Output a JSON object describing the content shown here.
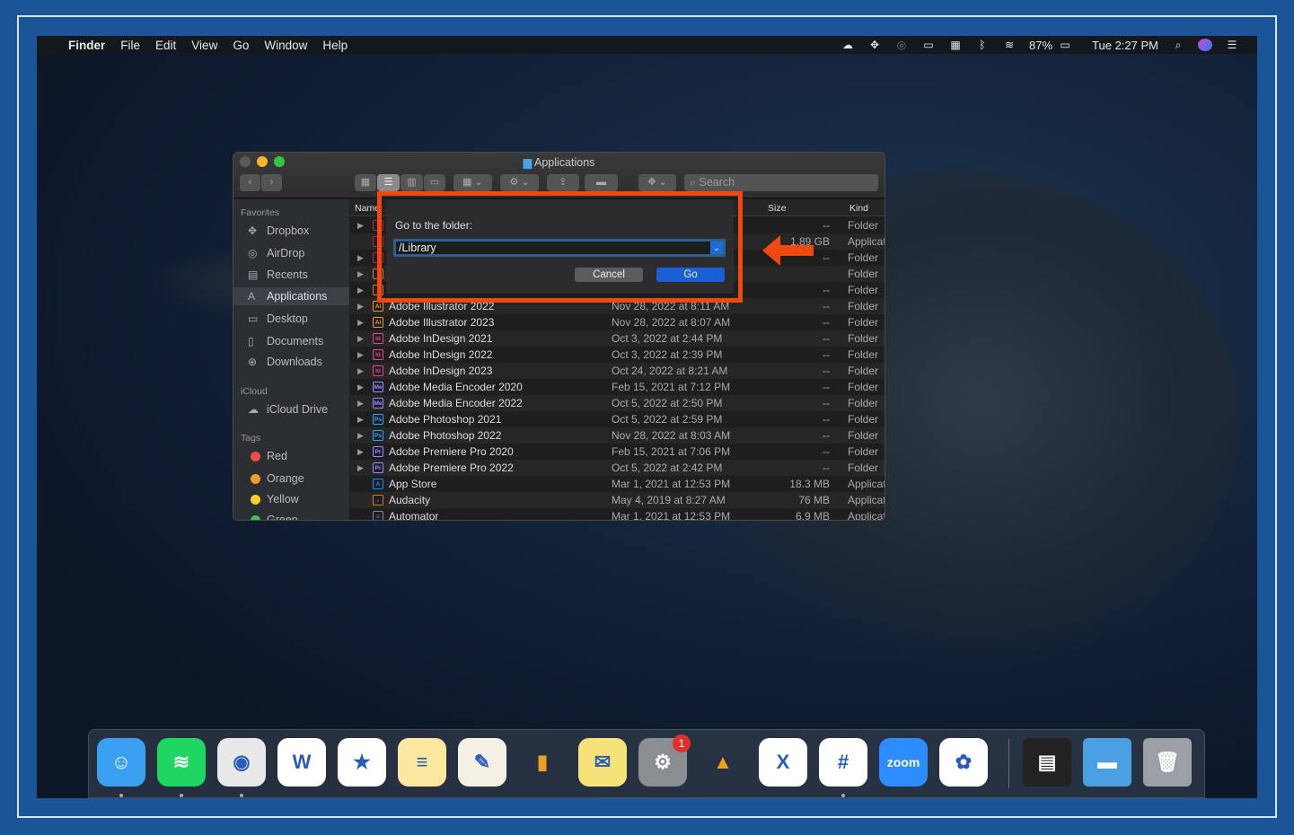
{
  "menubar": {
    "app": "Finder",
    "menus": [
      "File",
      "Edit",
      "View",
      "Go",
      "Window",
      "Help"
    ],
    "battery": "87%",
    "clock": "Tue 2:27 PM",
    "status_icons": [
      "creative-cloud-icon",
      "dropbox-icon",
      "spotlight-alt-icon",
      "airplay-icon",
      "control-icon",
      "bluetooth-icon",
      "wifi-icon",
      "battery-icon",
      "search-icon",
      "siri-icon",
      "notification-center-icon"
    ]
  },
  "window": {
    "title": "Applications",
    "search_placeholder": "Search"
  },
  "sidebar": {
    "favorites_header": "Favorites",
    "favorites": [
      {
        "label": "Dropbox",
        "icon": "dropbox-icon"
      },
      {
        "label": "AirDrop",
        "icon": "airdrop-icon"
      },
      {
        "label": "Recents",
        "icon": "recents-icon"
      },
      {
        "label": "Applications",
        "icon": "applications-icon"
      },
      {
        "label": "Desktop",
        "icon": "desktop-icon"
      },
      {
        "label": "Documents",
        "icon": "documents-icon"
      },
      {
        "label": "Downloads",
        "icon": "downloads-icon"
      }
    ],
    "icloud_header": "iCloud",
    "icloud": [
      {
        "label": "iCloud Drive",
        "icon": "cloud-icon"
      }
    ],
    "tags_header": "Tags",
    "tags": [
      {
        "label": "Red",
        "color": "#ee4b45"
      },
      {
        "label": "Orange",
        "color": "#f39a2c"
      },
      {
        "label": "Yellow",
        "color": "#f5cf2d"
      },
      {
        "label": "Green",
        "color": "#3fc34f"
      }
    ]
  },
  "list": {
    "columns": {
      "name": "Name",
      "size": "Size",
      "kind": "Kind"
    },
    "rows": [
      {
        "name": "",
        "date": "",
        "size": "--",
        "kind": "Folder",
        "folder": true,
        "badge": "",
        "color": "#c0202a"
      },
      {
        "name": "",
        "date": "",
        "size": "1.89 GB",
        "kind": "Application",
        "folder": false,
        "badge": "",
        "color": "#c0202a"
      },
      {
        "name": "",
        "date": "",
        "size": "--",
        "kind": "Folder",
        "folder": true,
        "badge": "",
        "color": "#c0202a"
      },
      {
        "name": "",
        "date": "",
        "size": "",
        "kind": "Folder",
        "folder": true,
        "badge": "",
        "color": "#e07a1a"
      },
      {
        "name": "",
        "date": "",
        "size": "--",
        "kind": "Folder",
        "folder": true,
        "badge": "",
        "color": "#e07a1a"
      },
      {
        "name": "Adobe Illustrator 2022",
        "date": "Nov 28, 2022 at 8:11 AM",
        "size": "--",
        "kind": "Folder",
        "folder": true,
        "badge": "Ai",
        "color": "#f29a1a"
      },
      {
        "name": "Adobe Illustrator 2023",
        "date": "Nov 28, 2022 at 8:07 AM",
        "size": "--",
        "kind": "Folder",
        "folder": true,
        "badge": "Ai",
        "color": "#f29a1a"
      },
      {
        "name": "Adobe InDesign 2021",
        "date": "Oct 3, 2022 at 2:44 PM",
        "size": "--",
        "kind": "Folder",
        "folder": true,
        "badge": "Id",
        "color": "#f0487a"
      },
      {
        "name": "Adobe InDesign 2022",
        "date": "Oct 3, 2022 at 2:39 PM",
        "size": "--",
        "kind": "Folder",
        "folder": true,
        "badge": "Id",
        "color": "#f0487a"
      },
      {
        "name": "Adobe InDesign 2023",
        "date": "Oct 24, 2022 at 8:21 AM",
        "size": "--",
        "kind": "Folder",
        "folder": true,
        "badge": "Id",
        "color": "#f0487a"
      },
      {
        "name": "Adobe Media Encoder 2020",
        "date": "Feb 15, 2021 at 7:12 PM",
        "size": "--",
        "kind": "Folder",
        "folder": true,
        "badge": "Me",
        "color": "#9b8cff"
      },
      {
        "name": "Adobe Media Encoder 2022",
        "date": "Oct 5, 2022 at 2:50 PM",
        "size": "--",
        "kind": "Folder",
        "folder": true,
        "badge": "Me",
        "color": "#9b8cff"
      },
      {
        "name": "Adobe Photoshop 2021",
        "date": "Oct 5, 2022 at 2:59 PM",
        "size": "--",
        "kind": "Folder",
        "folder": true,
        "badge": "Ps",
        "color": "#31a8ff"
      },
      {
        "name": "Adobe Photoshop 2022",
        "date": "Nov 28, 2022 at 8:03 AM",
        "size": "--",
        "kind": "Folder",
        "folder": true,
        "badge": "Ps",
        "color": "#31a8ff"
      },
      {
        "name": "Adobe Premiere Pro 2020",
        "date": "Feb 15, 2021 at 7:06 PM",
        "size": "--",
        "kind": "Folder",
        "folder": true,
        "badge": "Pr",
        "color": "#9b8cff"
      },
      {
        "name": "Adobe Premiere Pro 2022",
        "date": "Oct 5, 2022 at 2:42 PM",
        "size": "--",
        "kind": "Folder",
        "folder": true,
        "badge": "Pr",
        "color": "#9b8cff"
      },
      {
        "name": "App Store",
        "date": "Mar 1, 2021 at 12:53 PM",
        "size": "18.3 MB",
        "kind": "Application",
        "folder": false,
        "badge": "A",
        "color": "#1b8cf5"
      },
      {
        "name": "Audacity",
        "date": "May 4, 2019 at 8:27 AM",
        "size": "76 MB",
        "kind": "Application",
        "folder": false,
        "badge": "♪",
        "color": "#e07a1a"
      },
      {
        "name": "Automator",
        "date": "Mar 1, 2021 at 12:53 PM",
        "size": "6.9 MB",
        "kind": "Application",
        "folder": false,
        "badge": "☺",
        "color": "#888"
      }
    ]
  },
  "dialog": {
    "label": "Go to the folder:",
    "value": "/Library",
    "cancel": "Cancel",
    "go": "Go"
  },
  "annotation": {
    "highlight_color": "#f0480f"
  },
  "dock": {
    "apps": [
      {
        "name": "Finder",
        "icon": "finder-icon",
        "bg": "#3ba0f0",
        "glyph": "☺",
        "running": true
      },
      {
        "name": "Spotify",
        "icon": "spotify-icon",
        "bg": "#1ed760",
        "glyph": "≋",
        "running": true
      },
      {
        "name": "Google Chrome",
        "icon": "chrome-icon",
        "bg": "#e8e8e8",
        "glyph": "◉",
        "running": true
      },
      {
        "name": "Microsoft Word",
        "icon": "word-icon",
        "bg": "#ffffff",
        "glyph": "W",
        "running": false
      },
      {
        "name": "iMovie",
        "icon": "imovie-icon",
        "bg": "#ffffff",
        "glyph": "★",
        "running": false
      },
      {
        "name": "Notes",
        "icon": "notes-icon",
        "bg": "#fbe7a0",
        "glyph": "≡",
        "running": false
      },
      {
        "name": "Pages",
        "icon": "pages-icon",
        "bg": "#f5f0e6",
        "glyph": "✎",
        "running": false
      },
      {
        "name": "Numbers",
        "icon": "numbers-icon",
        "bg": "transparent",
        "glyph": "▮",
        "running": false
      },
      {
        "name": "Stickies",
        "icon": "stickies-icon",
        "bg": "#f7e27a",
        "glyph": "✉",
        "running": false
      },
      {
        "name": "System Preferences",
        "icon": "gear-icon",
        "bg": "#8a8d92",
        "glyph": "⚙",
        "running": false,
        "badge": "1"
      },
      {
        "name": "Google Drive",
        "icon": "google-drive-icon",
        "bg": "transparent",
        "glyph": "▲",
        "running": false
      },
      {
        "name": "Microsoft Excel",
        "icon": "excel-icon",
        "bg": "#ffffff",
        "glyph": "X",
        "running": false
      },
      {
        "name": "Slack",
        "icon": "slack-icon",
        "bg": "#ffffff",
        "glyph": "#",
        "running": true
      },
      {
        "name": "Zoom",
        "icon": "zoom-icon",
        "bg": "#2d8cff",
        "glyph": "zoom",
        "running": false
      },
      {
        "name": "Photos",
        "icon": "photos-icon",
        "bg": "#ffffff",
        "glyph": "✿",
        "running": false
      }
    ],
    "others": [
      {
        "name": "Screenshot",
        "icon": "screenshot-icon"
      },
      {
        "name": "Folder",
        "icon": "folder-icon"
      },
      {
        "name": "Trash",
        "icon": "trash-icon"
      }
    ]
  }
}
